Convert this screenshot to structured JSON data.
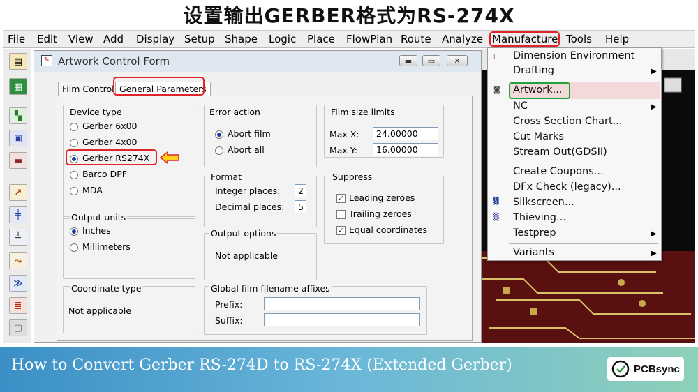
{
  "banner_title": "设置输出GERBER格式为RS-274X",
  "menubar": [
    "File",
    "Edit",
    "View",
    "Add",
    "Display",
    "Setup",
    "Shape",
    "Logic",
    "Place",
    "FlowPlan",
    "Route",
    "Analyze",
    "Manufacture",
    "Tools",
    "Help"
  ],
  "form": {
    "title": "Artwork Control Form",
    "tabs": [
      "Film Control",
      "General Parameters"
    ],
    "device_type": {
      "label": "Device type",
      "options": [
        "Gerber 6x00",
        "Gerber 4x00",
        "Gerber RS274X",
        "Barco DPF",
        "MDA"
      ],
      "selected": "Gerber RS274X"
    },
    "output_units": {
      "label": "Output units",
      "options": [
        "Inches",
        "Millimeters"
      ],
      "selected": "Inches"
    },
    "coordinate_type": {
      "label": "Coordinate type",
      "value": "Not applicable"
    },
    "error_action": {
      "label": "Error action",
      "options": [
        "Abort film",
        "Abort all"
      ],
      "selected": "Abort film"
    },
    "format": {
      "label": "Format",
      "integer_label": "Integer places:",
      "integer_value": "2",
      "decimal_label": "Decimal places:",
      "decimal_value": "5"
    },
    "output_options": {
      "label": "Output options",
      "value": "Not applicable"
    },
    "global_affixes": {
      "label": "Global film filename affixes",
      "prefix_label": "Prefix:",
      "suffix_label": "Suffix:",
      "prefix_value": "",
      "suffix_value": ""
    },
    "film_size": {
      "label": "Film size limits",
      "max_x_label": "Max X:",
      "max_x": "24.00000",
      "max_y_label": "Max Y:",
      "max_y": "16.00000"
    },
    "suppress": {
      "label": "Suppress",
      "options": [
        {
          "label": "Leading zeroes",
          "checked": true
        },
        {
          "label": "Trailing zeroes",
          "checked": false
        },
        {
          "label": "Equal coordinates",
          "checked": true
        }
      ]
    }
  },
  "manufacture_menu": [
    {
      "label": "Dimension Environment",
      "submenu": false
    },
    {
      "label": "Drafting",
      "submenu": true
    },
    {
      "label": "Artwork...",
      "submenu": false
    },
    {
      "label": "NC",
      "submenu": true
    },
    {
      "label": "Cross Section Chart...",
      "submenu": false
    },
    {
      "label": "Cut Marks",
      "submenu": false
    },
    {
      "label": "Stream Out(GDSII)",
      "submenu": false
    },
    {
      "label": "Create Coupons...",
      "submenu": false
    },
    {
      "label": "DFx Check (legacy)...",
      "submenu": false
    },
    {
      "label": "Silkscreen...",
      "submenu": false
    },
    {
      "label": "Thieving...",
      "submenu": false
    },
    {
      "label": "Testprep",
      "submenu": true
    },
    {
      "label": "Variants",
      "submenu": true
    }
  ],
  "footer": {
    "caption": "How to Convert Gerber RS-274D to RS-274X (Extended Gerber)",
    "brand": "PCBsync"
  },
  "colors": {
    "highlight_red": "#e0242a",
    "highlight_green": "#22a33a",
    "arrow_yellow": "#ffd21a",
    "footer_start": "#3b8fc6",
    "footer_end": "#8fd0b8"
  }
}
